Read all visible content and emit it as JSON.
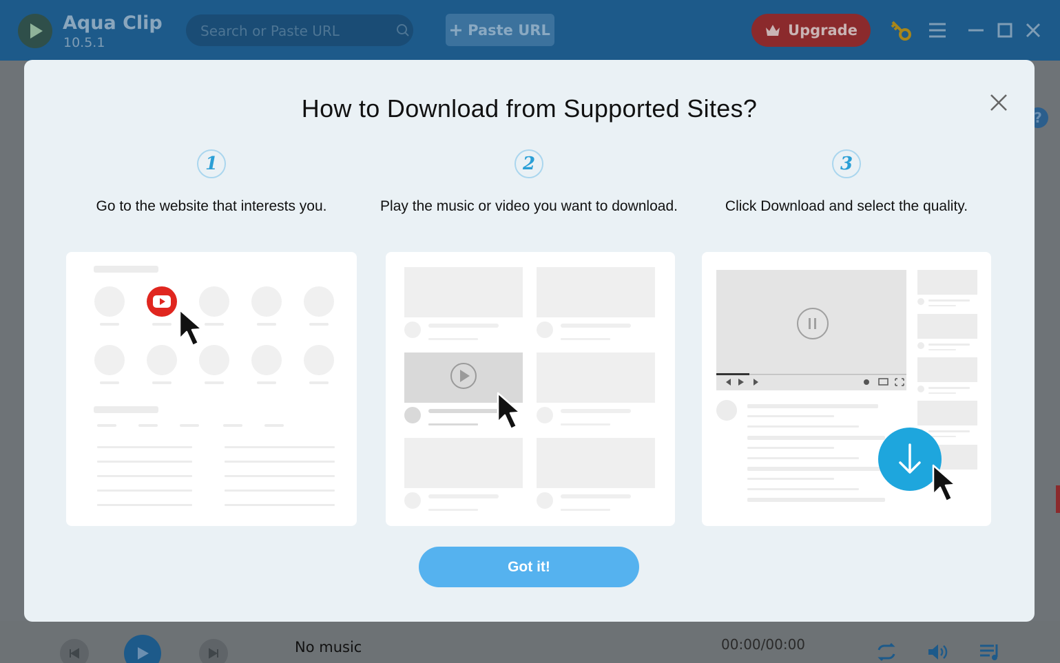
{
  "app": {
    "name": "Aqua Clip",
    "version": "10.5.1"
  },
  "header": {
    "search_placeholder": "Search or Paste URL",
    "paste_label": "Paste URL",
    "upgrade_label": "Upgrade",
    "icons": [
      "search-icon",
      "plus-icon",
      "crown-icon",
      "key-icon",
      "menu-icon",
      "minimize-icon",
      "maximize-icon",
      "close-icon"
    ]
  },
  "modal": {
    "title": "How to Download from Supported Sites?",
    "steps": [
      {
        "number": "1",
        "text": "Go to the website that interests you."
      },
      {
        "number": "2",
        "text": "Play the music or video you want to download."
      },
      {
        "number": "3",
        "text": "Click Download and select the quality."
      }
    ],
    "confirm_label": "Got it!"
  },
  "player": {
    "track": "No music",
    "time": "00:00/00:00"
  },
  "colors": {
    "accent": "#55b2ef",
    "brand_blue": "#1d5a8a",
    "upgrade_red": "#8b2a2c",
    "download_blue": "#1ea6dd",
    "youtube_red": "#e0261f"
  }
}
